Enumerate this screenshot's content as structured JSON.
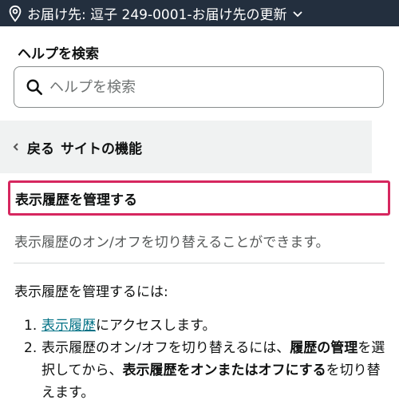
{
  "topbar": {
    "delivery_text": "お届け先: 逗子 249-0001‐お届け先の更新"
  },
  "help": {
    "title": "ヘルプを検索",
    "search_placeholder": "ヘルプを検索"
  },
  "breadcrumb": {
    "back_label": "戻る",
    "section_label": "サイトの機能"
  },
  "article": {
    "heading": "表示履歴を管理する",
    "description": "表示履歴のオン/オフを切り替えることができます。",
    "intro": "表示履歴を管理するには:",
    "steps": [
      {
        "number": "1.",
        "link_text": "表示履歴",
        "text_after_link": "にアクセスします。"
      },
      {
        "number": "2.",
        "text_1": "表示履歴のオン/オフを切り替えるには、",
        "bold_1": "履歴の管理",
        "text_2": "を選択してから、",
        "bold_2": "表示履歴をオンまたはオフにする",
        "text_3": "を切り替えます。"
      }
    ]
  },
  "colors": {
    "topbar_bg": "#232f3e",
    "highlight_border": "#d6275f",
    "link": "#007185"
  },
  "icons": [
    "location-pin-icon",
    "chevron-down-icon",
    "search-icon",
    "chevron-left-icon"
  ]
}
